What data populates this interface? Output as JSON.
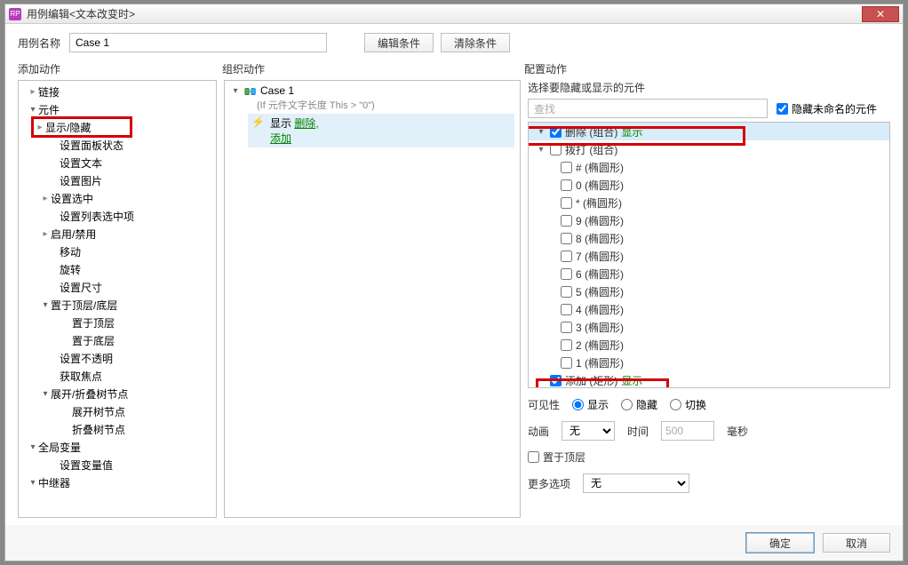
{
  "window": {
    "title": "用例编辑<文本改变时>"
  },
  "caseRow": {
    "label": "用例名称",
    "value": "Case 1",
    "editBtn": "编辑条件",
    "clearBtn": "清除条件"
  },
  "panels": {
    "left": "添加动作",
    "mid": "组织动作",
    "right": "配置动作"
  },
  "leftTree": {
    "links": "链接",
    "comp": "元件",
    "showHide": "显示/隐藏",
    "panelState": "设置面板状态",
    "setText": "设置文本",
    "setImage": "设置图片",
    "setSelected": "设置选中",
    "setListSel": "设置列表选中项",
    "enableDisable": "启用/禁用",
    "move": "移动",
    "rotate": "旋转",
    "setSize": "设置尺寸",
    "layer": "置于顶层/底层",
    "toFront": "置于顶层",
    "toBack": "置于底层",
    "opacity": "设置不透明",
    "focus": "获取焦点",
    "treeNode": "展开/折叠树节点",
    "expand": "展开树节点",
    "collapse": "折叠树节点",
    "globalVar": "全局变量",
    "setVar": "设置变量值",
    "repeater": "中继器"
  },
  "mid": {
    "caseName": "Case 1",
    "condition": "(If 元件文字长度 This > \"0\")",
    "actShow": "显示",
    "actDel": "删除,",
    "actAdd": "添加"
  },
  "right": {
    "pickLabel": "选择要隐藏或显示的元件",
    "searchPlaceholder": "查找",
    "hideUnnamed": "隐藏未命名的元件",
    "tree": {
      "del": "删除 (组合)",
      "dial": "拨打 (组合)",
      "hash": "# (椭圆形)",
      "d0": "0 (椭圆形)",
      "star": "* (椭圆形)",
      "d9": "9 (椭圆形)",
      "d8": "8 (椭圆形)",
      "d7": "7 (椭圆形)",
      "d6": "6 (椭圆形)",
      "d5": "5 (椭圆形)",
      "d4": "4 (椭圆形)",
      "d3": "3 (椭圆形)",
      "d2": "2 (椭圆形)",
      "d1": "1 (椭圆形)",
      "add": "添加 (矩形)"
    },
    "showTag": "显示",
    "opts": {
      "visibility": "可见性",
      "show": "显示",
      "hide": "隐藏",
      "toggle": "切换",
      "anim": "动画",
      "none": "无",
      "time": "时间",
      "timeVal": "500",
      "ms": "毫秒",
      "toFront": "置于顶层",
      "more": "更多选项"
    }
  },
  "footer": {
    "ok": "确定",
    "cancel": "取消"
  }
}
